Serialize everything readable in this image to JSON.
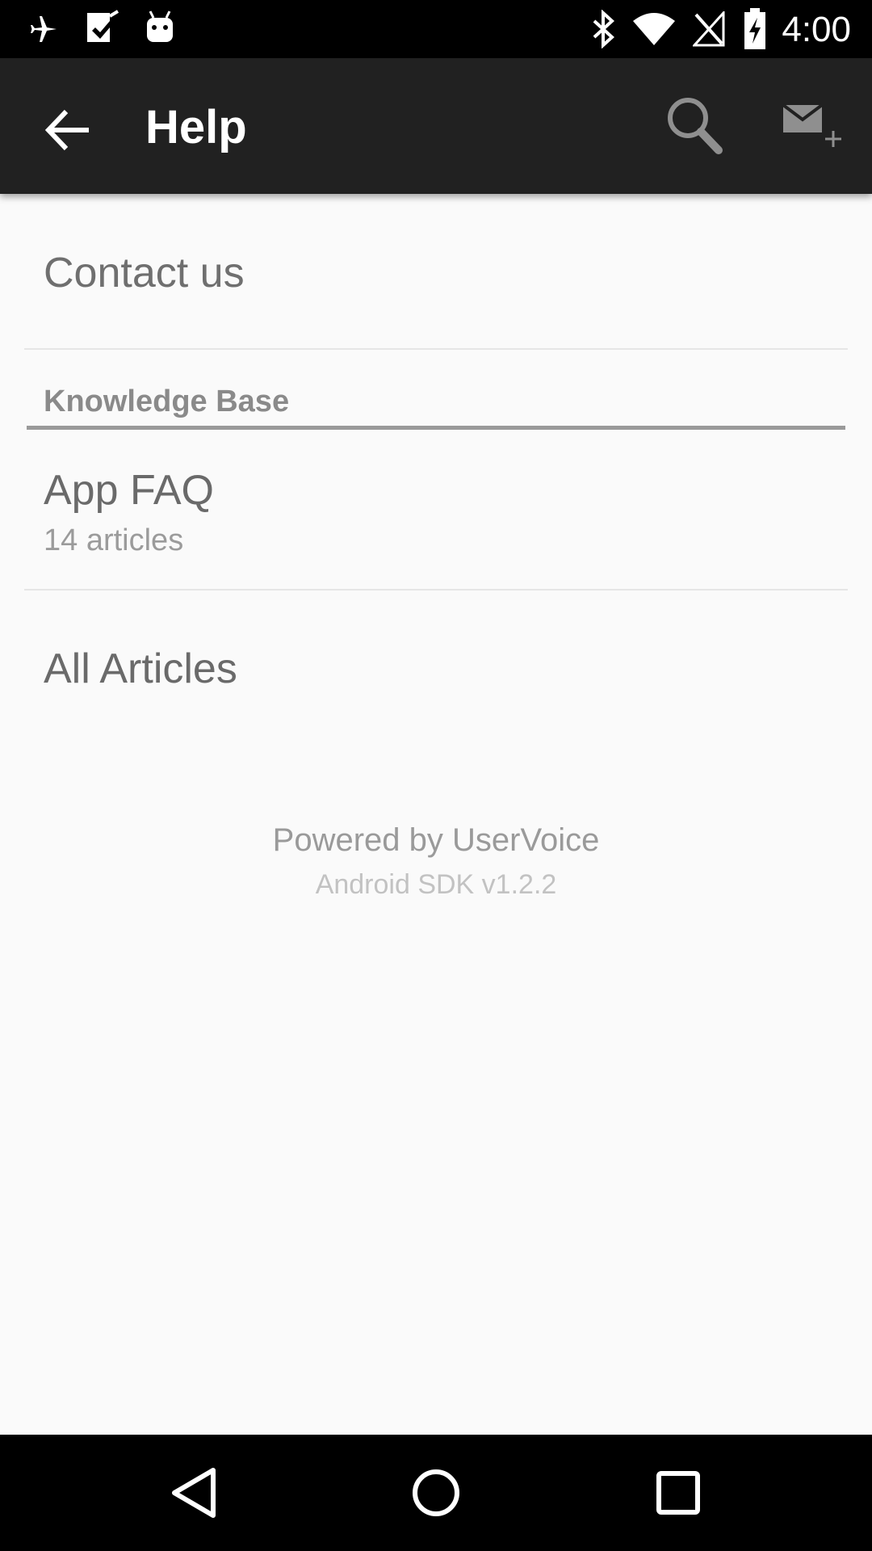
{
  "status_bar": {
    "time": "4:00",
    "icons": [
      "airplane-icon",
      "checklist-icon",
      "android-icon",
      "bluetooth-icon",
      "wifi-icon",
      "no-signal-icon",
      "battery-charging-icon"
    ]
  },
  "app_bar": {
    "title": "Help",
    "background": "#212121",
    "icons": [
      "back-arrow-icon",
      "search-icon",
      "compose-message-icon"
    ]
  },
  "content": {
    "contact_us": "Contact us",
    "knowledge_base_header": "Knowledge Base",
    "topics": [
      {
        "title": "App FAQ",
        "subtitle": "14 articles"
      }
    ],
    "all_articles": "All Articles",
    "powered_by": "Powered by UserVoice",
    "sdk_version": "Android SDK v1.2.2"
  },
  "nav_bar": {
    "icons": [
      "back-triangle-icon",
      "home-circle-icon",
      "recents-square-icon"
    ]
  }
}
